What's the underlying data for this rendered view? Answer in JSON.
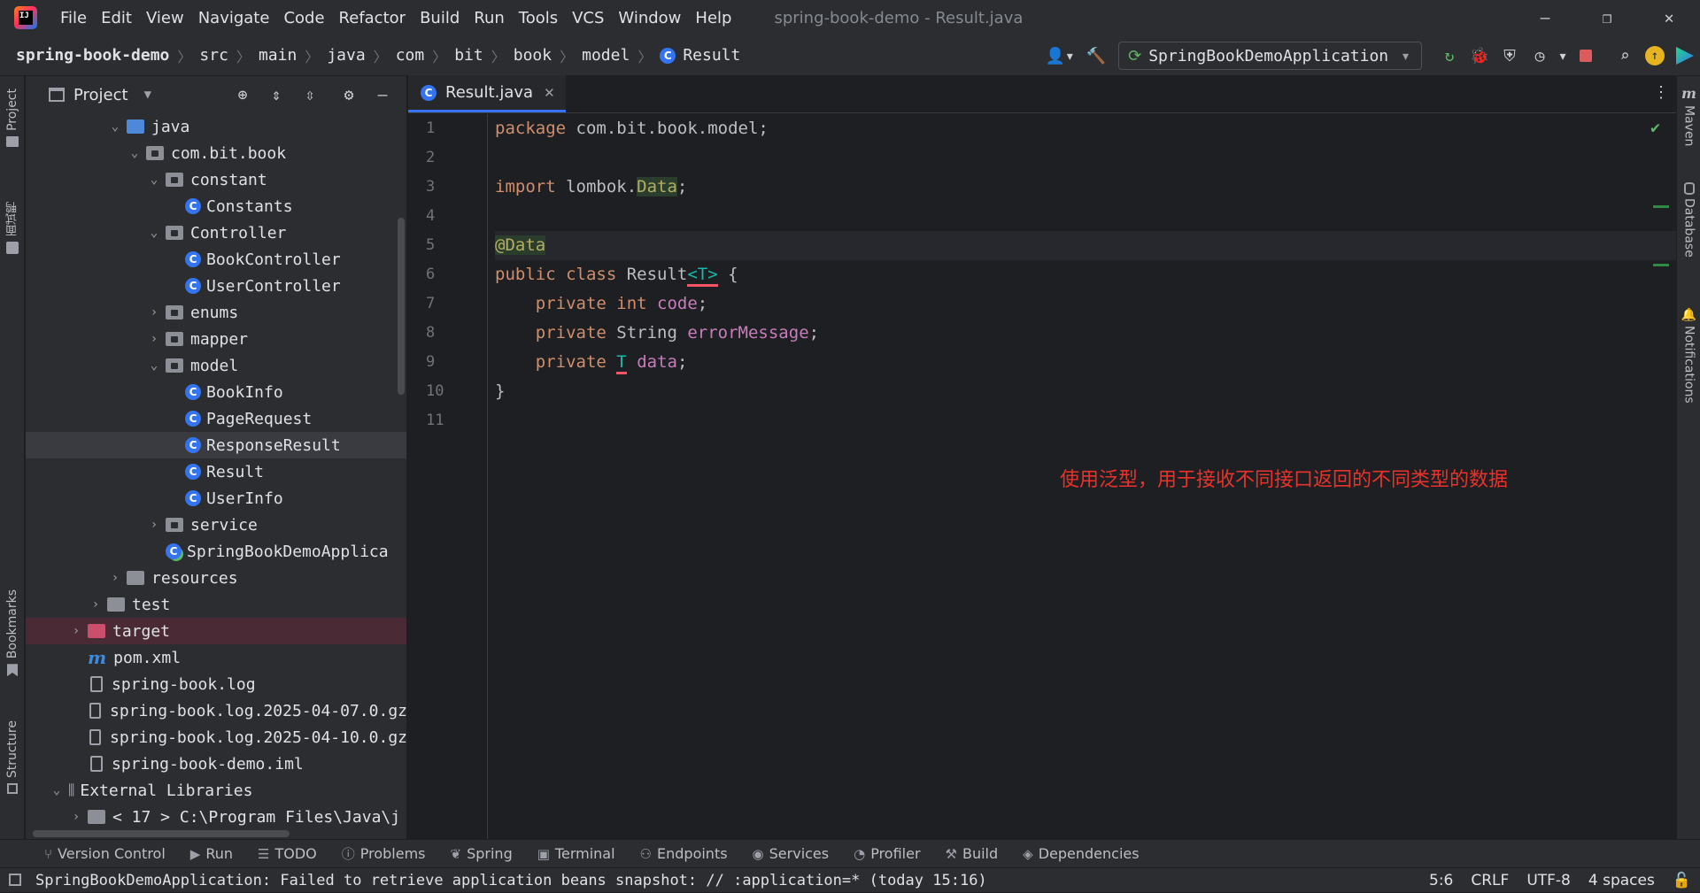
{
  "window": {
    "title": "spring-book-demo - Result.java",
    "menu": [
      "File",
      "Edit",
      "View",
      "Navigate",
      "Code",
      "Refactor",
      "Build",
      "Run",
      "Tools",
      "VCS",
      "Window",
      "Help"
    ],
    "controls": {
      "minimize": "—",
      "restore": "❐",
      "close": "✕"
    }
  },
  "breadcrumb": [
    "spring-book-demo",
    "src",
    "main",
    "java",
    "com",
    "bit",
    "book",
    "model",
    "Result"
  ],
  "run_config": {
    "label": "SpringBookDemoApplication"
  },
  "left_strip": {
    "project": "Project",
    "cn_tab": "面试鸭",
    "bookmarks": "Bookmarks",
    "structure": "Structure"
  },
  "right_strip": {
    "maven": "Maven",
    "database": "Database",
    "notifications": "Notifications"
  },
  "project_panel": {
    "title": "Project",
    "tree": [
      {
        "label": "java",
        "indent": 3,
        "arrow": "down",
        "icon": "folder-blue"
      },
      {
        "label": "com.bit.book",
        "indent": 4,
        "arrow": "down",
        "icon": "package"
      },
      {
        "label": "constant",
        "indent": 5,
        "arrow": "down",
        "icon": "package"
      },
      {
        "label": "Constants",
        "indent": 6,
        "arrow": "",
        "icon": "class"
      },
      {
        "label": "Controller",
        "indent": 5,
        "arrow": "down",
        "icon": "package"
      },
      {
        "label": "BookController",
        "indent": 6,
        "arrow": "",
        "icon": "class"
      },
      {
        "label": "UserController",
        "indent": 6,
        "arrow": "",
        "icon": "class"
      },
      {
        "label": "enums",
        "indent": 5,
        "arrow": "right",
        "icon": "package"
      },
      {
        "label": "mapper",
        "indent": 5,
        "arrow": "right",
        "icon": "package"
      },
      {
        "label": "model",
        "indent": 5,
        "arrow": "down",
        "icon": "package"
      },
      {
        "label": "BookInfo",
        "indent": 6,
        "arrow": "",
        "icon": "class"
      },
      {
        "label": "PageRequest",
        "indent": 6,
        "arrow": "",
        "icon": "class"
      },
      {
        "label": "ResponseResult",
        "indent": 6,
        "arrow": "",
        "icon": "class",
        "selected": true
      },
      {
        "label": "Result",
        "indent": 6,
        "arrow": "",
        "icon": "class"
      },
      {
        "label": "UserInfo",
        "indent": 6,
        "arrow": "",
        "icon": "class"
      },
      {
        "label": "service",
        "indent": 5,
        "arrow": "right",
        "icon": "package"
      },
      {
        "label": "SpringBookDemoApplica",
        "indent": 5,
        "arrow": "",
        "icon": "spring-class"
      },
      {
        "label": "resources",
        "indent": 3,
        "arrow": "right",
        "icon": "folder"
      },
      {
        "label": "test",
        "indent": 2,
        "arrow": "right",
        "icon": "folder"
      },
      {
        "label": "target",
        "indent": 1,
        "arrow": "right",
        "icon": "folder-red",
        "excluded": true
      },
      {
        "label": "pom.xml",
        "indent": 1,
        "arrow": "",
        "icon": "maven"
      },
      {
        "label": "spring-book.log",
        "indent": 1,
        "arrow": "",
        "icon": "file"
      },
      {
        "label": "spring-book.log.2025-04-07.0.gz",
        "indent": 1,
        "arrow": "",
        "icon": "file"
      },
      {
        "label": "spring-book.log.2025-04-10.0.gz",
        "indent": 1,
        "arrow": "",
        "icon": "file"
      },
      {
        "label": "spring-book-demo.iml",
        "indent": 1,
        "arrow": "",
        "icon": "file"
      },
      {
        "label": "External Libraries",
        "indent": 0,
        "arrow": "down",
        "icon": "library"
      },
      {
        "label": "< 17 >  C:\\Program Files\\Java\\j",
        "indent": 1,
        "arrow": "right",
        "icon": "folder"
      }
    ]
  },
  "editor": {
    "tab": "Result.java",
    "line_numbers": [
      "1",
      "2",
      "3",
      "4",
      "5",
      "6",
      "7",
      "8",
      "9",
      "10",
      "11"
    ],
    "code": {
      "l1_kw": "package",
      "l1_rest": " com.bit.book.model;",
      "l3_kw": "import",
      "l3_pkg": " lombok.",
      "l3_cls": "Data",
      "l3_end": ";",
      "l5_ann": "@Data",
      "l6_kw": "public class",
      "l6_name": " Result",
      "l6_tp": "<T>",
      "l6_end": " {",
      "l7_kw": "    private int",
      "l7_fld": " code",
      "l7_end": ";",
      "l8_kw": "    private",
      "l8_type": " String",
      "l8_fld": " errorMessage",
      "l8_end": ";",
      "l9_kw": "    private",
      "l9_tp": "T",
      "l9_fld": "data",
      "l9_end": ";",
      "l10": "}"
    },
    "note": "使用泛型，用于接收不同接口返回的不同类型的数据"
  },
  "toolwindows": [
    "Version Control",
    "Run",
    "TODO",
    "Problems",
    "Spring",
    "Terminal",
    "Endpoints",
    "Services",
    "Profiler",
    "Build",
    "Dependencies"
  ],
  "status": {
    "message": "SpringBookDemoApplication: Failed to retrieve application beans snapshot: // :application=* (today 15:16)",
    "position": "5:6",
    "line_sep": "CRLF",
    "encoding": "UTF-8",
    "indent": "4 spaces"
  }
}
